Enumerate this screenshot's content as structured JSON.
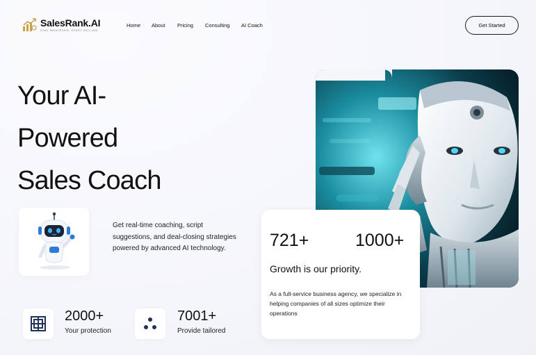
{
  "brand": {
    "name": "SalesRank.AI",
    "tagline": "STAY WHATEVER, START SELLING",
    "accent": "#c9a24a"
  },
  "nav": {
    "items": [
      "Home",
      "About",
      "Pricing",
      "Consulting",
      "AI Coach"
    ],
    "cta_label": "Get Started"
  },
  "hero": {
    "title_lines": [
      "Your AI-",
      "Powered",
      "Sales Coach"
    ],
    "description": "Get real-time coaching, script suggestions, and deal-closing strategies powered by advanced AI technology."
  },
  "stats_card": {
    "stat_a": "721+",
    "stat_b": "1000+",
    "headline": "Growth is our priority.",
    "description": "As a full-service business agency, we specialize in helping companies of all sizes optimize their operations"
  },
  "features": [
    {
      "icon": "layout-icon",
      "value": "2000+",
      "label": "Your protection"
    },
    {
      "icon": "dots-icon",
      "value": "7001+",
      "label": "Provide tailored"
    }
  ],
  "colors": {
    "icon_navy": "#1f3358",
    "robot_blue": "#2e7bd6",
    "image_teal": "#1bb6c8"
  }
}
